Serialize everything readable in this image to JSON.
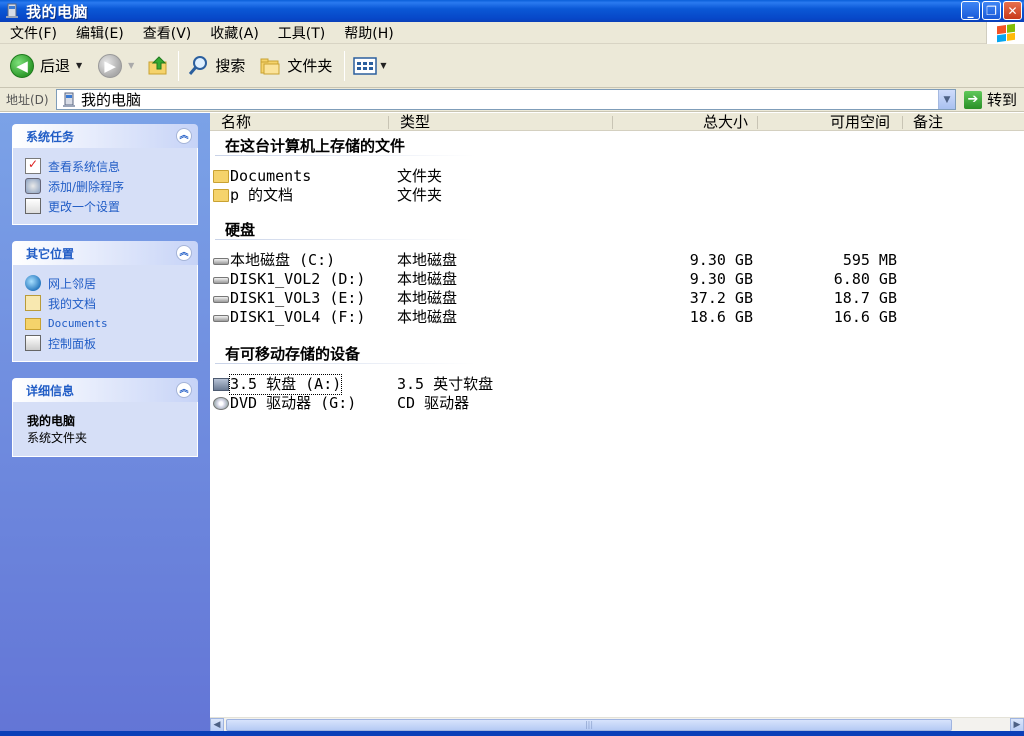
{
  "window": {
    "title": "我的电脑"
  },
  "menu": [
    "文件(F)",
    "编辑(E)",
    "查看(V)",
    "收藏(A)",
    "工具(T)",
    "帮助(H)"
  ],
  "toolbar": {
    "back": "后退",
    "search": "搜索",
    "folders": "文件夹"
  },
  "address": {
    "label": "地址(D)",
    "value": "我的电脑",
    "go": "转到"
  },
  "panels": {
    "system_tasks": {
      "title": "系统任务",
      "links": [
        "查看系统信息",
        "添加/删除程序",
        "更改一个设置"
      ]
    },
    "other_places": {
      "title": "其它位置",
      "links": [
        "网上邻居",
        "我的文档",
        "Documents",
        "控制面板"
      ]
    },
    "details": {
      "title": "详细信息",
      "name": "我的电脑",
      "desc": "系统文件夹"
    }
  },
  "columns": {
    "name": "名称",
    "type": "类型",
    "total": "总大小",
    "free": "可用空间",
    "comment": "备注"
  },
  "groups": {
    "stored": {
      "title": "在这台计算机上存储的文件",
      "items": [
        {
          "name": "Documents",
          "type": "文件夹"
        },
        {
          "name": "p 的文档",
          "type": "文件夹"
        }
      ]
    },
    "hdd": {
      "title": "硬盘",
      "items": [
        {
          "name": "本地磁盘 (C:)",
          "type": "本地磁盘",
          "total": "9.30 GB",
          "free": "595 MB"
        },
        {
          "name": "DISK1_VOL2 (D:)",
          "type": "本地磁盘",
          "total": "9.30 GB",
          "free": "6.80 GB"
        },
        {
          "name": "DISK1_VOL3 (E:)",
          "type": "本地磁盘",
          "total": "37.2 GB",
          "free": "18.7 GB"
        },
        {
          "name": "DISK1_VOL4 (F:)",
          "type": "本地磁盘",
          "total": "18.6 GB",
          "free": "16.6 GB"
        }
      ]
    },
    "removable": {
      "title": "有可移动存储的设备",
      "items": [
        {
          "name": "3.5 软盘 (A:)",
          "type": "3.5 英寸软盘"
        },
        {
          "name": "DVD 驱动器 (G:)",
          "type": "CD 驱动器"
        }
      ]
    }
  }
}
